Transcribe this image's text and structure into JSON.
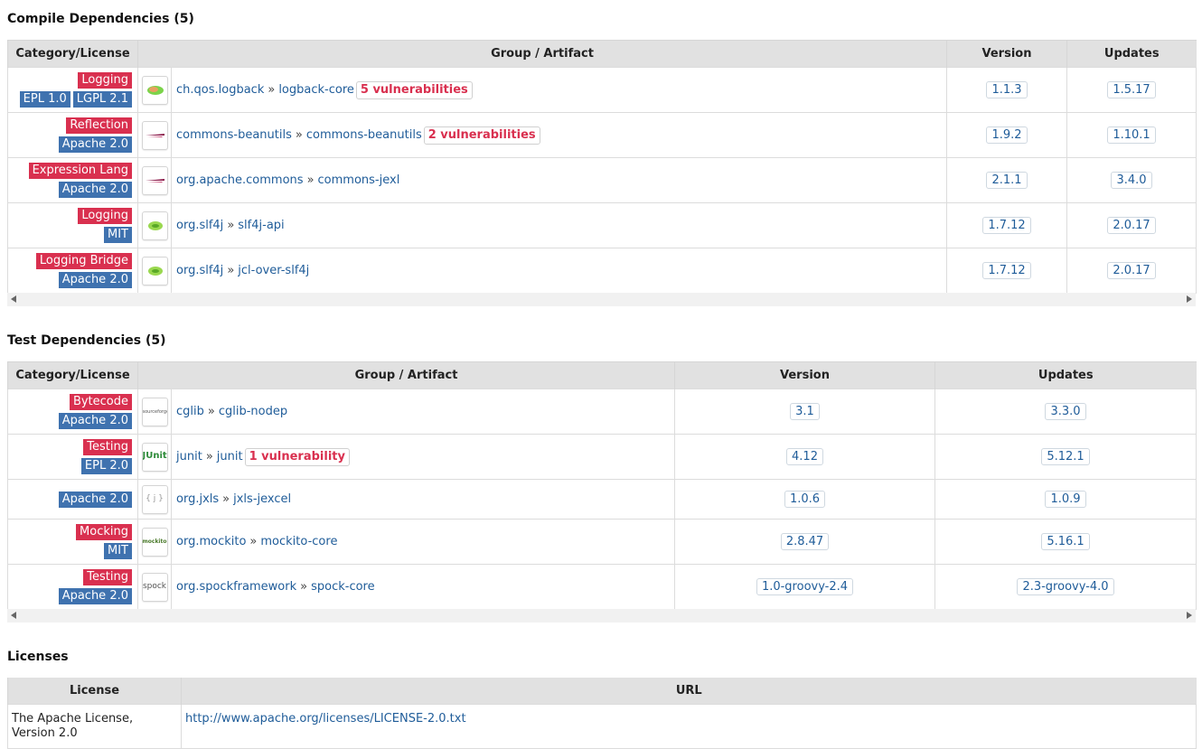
{
  "compile": {
    "title": "Compile Dependencies (5)",
    "headers": {
      "category": "Category/License",
      "artifact": "Group / Artifact",
      "version": "Version",
      "updates": "Updates"
    },
    "rows": [
      {
        "categories": [
          "Logging"
        ],
        "licenses": [
          "EPL 1.0",
          "LGPL 2.1"
        ],
        "logo": "logback-logo",
        "group": "ch.qos.logback",
        "artifact": "logback-core",
        "vuln": "5 vulnerabilities",
        "version": "1.1.3",
        "update": "1.5.17"
      },
      {
        "categories": [
          "Reflection"
        ],
        "licenses": [
          "Apache 2.0"
        ],
        "logo": "apache-feather-logo",
        "group": "commons-beanutils",
        "artifact": "commons-beanutils",
        "vuln": "2 vulnerabilities",
        "version": "1.9.2",
        "update": "1.10.1"
      },
      {
        "categories": [
          "Expression Lang"
        ],
        "licenses": [
          "Apache 2.0"
        ],
        "logo": "apache-feather-logo",
        "group": "org.apache.commons",
        "artifact": "commons-jexl",
        "vuln": "",
        "version": "2.1.1",
        "update": "3.4.0"
      },
      {
        "categories": [
          "Logging"
        ],
        "licenses": [
          "MIT"
        ],
        "logo": "slf4j-logo",
        "group": "org.slf4j",
        "artifact": "slf4j-api",
        "vuln": "",
        "version": "1.7.12",
        "update": "2.0.17"
      },
      {
        "categories": [
          "Logging Bridge"
        ],
        "licenses": [
          "Apache 2.0"
        ],
        "logo": "slf4j-logo",
        "group": "org.slf4j",
        "artifact": "jcl-over-slf4j",
        "vuln": "",
        "version": "1.7.12",
        "update": "2.0.17"
      }
    ]
  },
  "test": {
    "title": "Test Dependencies (5)",
    "headers": {
      "category": "Category/License",
      "artifact": "Group / Artifact",
      "version": "Version",
      "updates": "Updates"
    },
    "rows": [
      {
        "categories": [
          "Bytecode"
        ],
        "licenses": [
          "Apache 2.0"
        ],
        "logo": "sourceforge-logo",
        "group": "cglib",
        "artifact": "cglib-nodep",
        "vuln": "",
        "version": "3.1",
        "update": "3.3.0"
      },
      {
        "categories": [
          "Testing"
        ],
        "licenses": [
          "EPL 2.0"
        ],
        "logo": "junit-logo",
        "group": "junit",
        "artifact": "junit",
        "vuln": "1 vulnerability",
        "version": "4.12",
        "update": "5.12.1"
      },
      {
        "categories": [],
        "licenses": [
          "Apache 2.0"
        ],
        "logo": "json-braces-logo",
        "group": "org.jxls",
        "artifact": "jxls-jexcel",
        "vuln": "",
        "version": "1.0.6",
        "update": "1.0.9"
      },
      {
        "categories": [
          "Mocking"
        ],
        "licenses": [
          "MIT"
        ],
        "logo": "mockito-logo",
        "group": "org.mockito",
        "artifact": "mockito-core",
        "vuln": "",
        "version": "2.8.47",
        "update": "5.16.1"
      },
      {
        "categories": [
          "Testing"
        ],
        "licenses": [
          "Apache 2.0"
        ],
        "logo": "spock-logo",
        "group": "org.spockframework",
        "artifact": "spock-core",
        "vuln": "",
        "version": "1.0-groovy-2.4",
        "update": "2.3-groovy-4.0"
      }
    ]
  },
  "licenses": {
    "title": "Licenses",
    "headers": {
      "license": "License",
      "url": "URL"
    },
    "rows": [
      {
        "license": "The Apache License, Version 2.0",
        "url": "http://www.apache.org/licenses/LICENSE-2.0.txt"
      }
    ]
  },
  "logo_text": {
    "sourceforge-logo": "sourceforge",
    "junit-logo": "JUnit",
    "json-braces-logo": "{ j }",
    "mockito-logo": "mockito",
    "spock-logo": "spock"
  },
  "colors": {
    "category": "#d9304f",
    "license": "#3f72af",
    "link": "#1f5c99",
    "vuln": "#d9304f",
    "header_bg": "#e1e1e1"
  }
}
